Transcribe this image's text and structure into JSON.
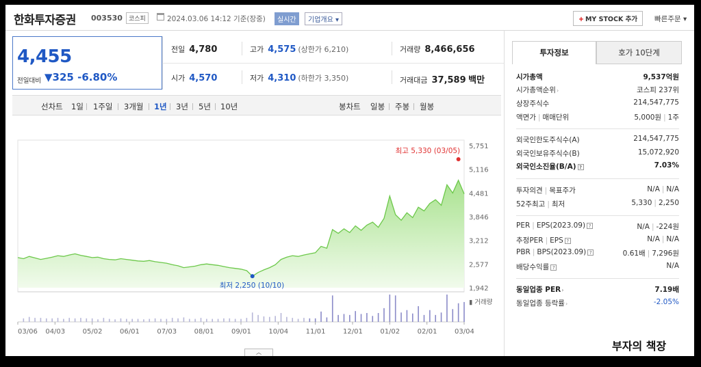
{
  "header": {
    "title": "한화투자증권",
    "code": "003530",
    "market": "코스피",
    "datetime": "2024.03.06 14:12 기준(장중)",
    "realtime_label": "실시간",
    "company_info_label": "기업개요",
    "my_stock_label": "MY STOCK 추가",
    "quick_order_label": "빠른주문"
  },
  "price": {
    "current": "4,455",
    "change_label": "전일대비",
    "change": "▼325",
    "change_pct": "-6.80%"
  },
  "stats": {
    "prev_close": {
      "label": "전일",
      "value": "4,780"
    },
    "open": {
      "label": "시가",
      "value": "4,570"
    },
    "high": {
      "label": "고가",
      "value": "4,575",
      "sub": "(상한가 6,210)"
    },
    "low": {
      "label": "저가",
      "value": "4,310",
      "sub": "(하한가 3,350)"
    },
    "volume": {
      "label": "거래량",
      "value": "8,466,656"
    },
    "amount": {
      "label": "거래대금",
      "value": "37,589",
      "unit": "백만"
    }
  },
  "period_bar": {
    "line_label": "선차트",
    "periods": [
      "1일",
      "1주일",
      "3개월",
      "1년",
      "3년",
      "5년",
      "10년"
    ],
    "active": "1년",
    "candle_label": "봉차트",
    "candles": [
      "일봉",
      "주봉",
      "월봉"
    ]
  },
  "chart_data": {
    "type": "area",
    "x_ticks": [
      "03/06",
      "04/03",
      "05/02",
      "06/01",
      "07/03",
      "08/01",
      "09/01",
      "10/04",
      "11/01",
      "12/01",
      "01/02",
      "02/01",
      "03/04"
    ],
    "y_ticks": [
      "5,751",
      "5,116",
      "4,481",
      "3,846",
      "3,212",
      "2,577",
      "1,942"
    ],
    "ylim": [
      1942,
      5751
    ],
    "series": [
      {
        "values": [
          2750,
          2720,
          2780,
          2740,
          2700,
          2730,
          2760,
          2800,
          2780,
          2820,
          2850,
          2810,
          2780,
          2750,
          2760,
          2720,
          2700,
          2690,
          2720,
          2700,
          2680,
          2660,
          2650,
          2670,
          2640,
          2620,
          2600,
          2560,
          2530,
          2480,
          2500,
          2520,
          2560,
          2580,
          2560,
          2540,
          2510,
          2480,
          2460,
          2440,
          2400,
          2250,
          2350,
          2420,
          2480,
          2560,
          2700,
          2760,
          2800,
          2780,
          2820,
          2850,
          2880,
          3050,
          3000,
          3500,
          3400,
          3520,
          3420,
          3600,
          3480,
          3620,
          3700,
          3560,
          3800,
          4400,
          3900,
          3750,
          3950,
          3820,
          4100,
          4000,
          4200,
          4300,
          4150,
          4700,
          4480,
          4820,
          4455
        ]
      }
    ],
    "high_annotation": "최고 5,330 (03/05)",
    "low_annotation": "최저 2,250 (10/10)",
    "volume_label": "거래량"
  },
  "sidebar": {
    "tabs": [
      "투자정보",
      "호가 10단계"
    ],
    "market_cap": {
      "label": "시가총액",
      "value": "9,537억원"
    },
    "market_cap_rank": {
      "label": "시가총액순위",
      "value": "코스피 237위"
    },
    "shares": {
      "label": "상장주식수",
      "value": "214,547,775"
    },
    "par_unit": {
      "label1": "액면가",
      "label2": "매매단위",
      "value1": "5,000원",
      "value2": "1주"
    },
    "foreign_limit": {
      "label": "외국인한도주식수(A)",
      "value": "214,547,775"
    },
    "foreign_hold": {
      "label": "외국인보유주식수(B)",
      "value": "15,072,920"
    },
    "foreign_ratio": {
      "label": "외국인소진율(B/A)",
      "value": "7.03%"
    },
    "opinion": {
      "label1": "투자의견",
      "label2": "목표주가",
      "value1": "N/A",
      "value2": "N/A"
    },
    "w52": {
      "label1": "52주최고",
      "label2": "최저",
      "value1": "5,330",
      "value2": "2,250"
    },
    "per_eps": {
      "label1": "PER",
      "label2": "EPS(2023.09)",
      "value1": "N/A",
      "value2": "-224원"
    },
    "est_per_eps": {
      "label1": "추정PER",
      "label2": "EPS",
      "value1": "N/A",
      "value2": "N/A"
    },
    "pbr_bps": {
      "label1": "PBR",
      "label2": "BPS(2023.09)",
      "value1": "0.61배",
      "value2": "7,296원"
    },
    "dividend": {
      "label": "배당수익률",
      "value": "N/A"
    },
    "peer_per": {
      "label": "동일업종 PER",
      "value": "7.19배"
    },
    "peer_change": {
      "label": "동일업종 등락률",
      "value": "-2.05%"
    }
  },
  "watermark": "부자의 책장",
  "colors": {
    "accent": "#1f58c4",
    "up": "#e03131",
    "chart_line": "#6cc84a",
    "chart_fill": "#d8f3cc"
  }
}
